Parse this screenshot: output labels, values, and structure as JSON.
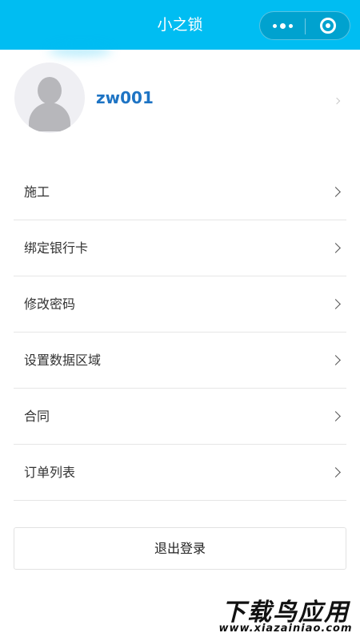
{
  "colors": {
    "accent": "#00bdf2",
    "username": "#1e74c4"
  },
  "navbar": {
    "title": "小之锁",
    "more_icon": "more-dots-icon",
    "close_icon": "close-target-icon"
  },
  "profile": {
    "username": "zw001",
    "avatar_icon": "default-avatar-icon"
  },
  "menu": {
    "items": [
      {
        "label": "施工"
      },
      {
        "label": "绑定银行卡"
      },
      {
        "label": "修改密码"
      },
      {
        "label": "设置数据区域"
      },
      {
        "label": "合同"
      },
      {
        "label": "订单列表"
      }
    ]
  },
  "logout": {
    "label": "退出登录"
  },
  "watermark": {
    "main": "下载鸟应用",
    "url": "www.xiazainiao.com"
  }
}
